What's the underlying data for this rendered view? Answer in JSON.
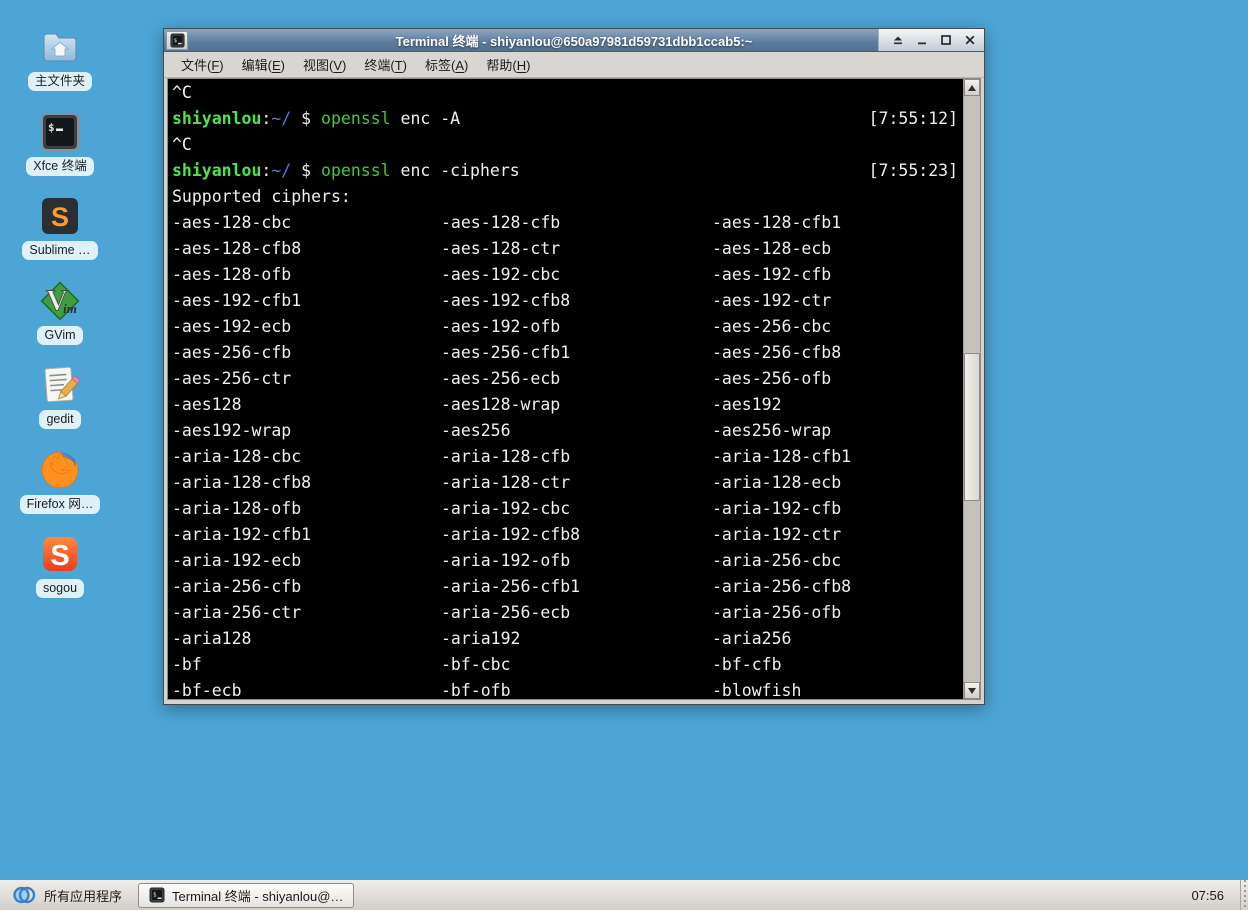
{
  "desktop": {
    "icons": [
      {
        "id": "home-folder",
        "label": "主文件夹"
      },
      {
        "id": "xfce-terminal",
        "label": "Xfce 终端"
      },
      {
        "id": "sublime",
        "label": "Sublime …"
      },
      {
        "id": "gvim",
        "label": "GVim"
      },
      {
        "id": "gedit",
        "label": "gedit"
      },
      {
        "id": "firefox",
        "label": "Firefox 网…"
      },
      {
        "id": "sogou",
        "label": "sogou"
      }
    ]
  },
  "window": {
    "title": "Terminal 终端 - shiyanlou@650a97981d59731dbb1ccab5:~",
    "menu": [
      {
        "id": "file",
        "label": "文件(F)"
      },
      {
        "id": "edit",
        "label": "编辑(E)"
      },
      {
        "id": "view",
        "label": "视图(V)"
      },
      {
        "id": "terminal",
        "label": "终端(T)"
      },
      {
        "id": "tabs",
        "label": "标签(A)"
      },
      {
        "id": "help",
        "label": "帮助(H)"
      }
    ],
    "buttons": [
      {
        "id": "shade"
      },
      {
        "id": "minimize"
      },
      {
        "id": "maximize"
      },
      {
        "id": "close"
      }
    ]
  },
  "terminal": {
    "symbols": {
      "colon": ":",
      "dollar": "$"
    },
    "lines": [
      {
        "type": "plain",
        "text": "^C"
      },
      {
        "type": "prompt",
        "user": "shiyanlou",
        "path": "~/",
        "command": "openssl",
        "args": "enc -A",
        "time": "[7:55:12]"
      },
      {
        "type": "plain",
        "text": "^C"
      },
      {
        "type": "prompt",
        "user": "shiyanlou",
        "path": "~/",
        "command": "openssl",
        "args": "enc -ciphers",
        "time": "[7:55:23]"
      },
      {
        "type": "plain",
        "text": "Supported ciphers:"
      },
      {
        "type": "ciphers",
        "cols": [
          "-aes-128-cbc",
          "-aes-128-cfb",
          "-aes-128-cfb1"
        ]
      },
      {
        "type": "ciphers",
        "cols": [
          "-aes-128-cfb8",
          "-aes-128-ctr",
          "-aes-128-ecb"
        ]
      },
      {
        "type": "ciphers",
        "cols": [
          "-aes-128-ofb",
          "-aes-192-cbc",
          "-aes-192-cfb"
        ]
      },
      {
        "type": "ciphers",
        "cols": [
          "-aes-192-cfb1",
          "-aes-192-cfb8",
          "-aes-192-ctr"
        ]
      },
      {
        "type": "ciphers",
        "cols": [
          "-aes-192-ecb",
          "-aes-192-ofb",
          "-aes-256-cbc"
        ]
      },
      {
        "type": "ciphers",
        "cols": [
          "-aes-256-cfb",
          "-aes-256-cfb1",
          "-aes-256-cfb8"
        ]
      },
      {
        "type": "ciphers",
        "cols": [
          "-aes-256-ctr",
          "-aes-256-ecb",
          "-aes-256-ofb"
        ]
      },
      {
        "type": "ciphers",
        "cols": [
          "-aes128",
          "-aes128-wrap",
          "-aes192"
        ]
      },
      {
        "type": "ciphers",
        "cols": [
          "-aes192-wrap",
          "-aes256",
          "-aes256-wrap"
        ]
      },
      {
        "type": "ciphers",
        "cols": [
          "-aria-128-cbc",
          "-aria-128-cfb",
          "-aria-128-cfb1"
        ]
      },
      {
        "type": "ciphers",
        "cols": [
          "-aria-128-cfb8",
          "-aria-128-ctr",
          "-aria-128-ecb"
        ]
      },
      {
        "type": "ciphers",
        "cols": [
          "-aria-128-ofb",
          "-aria-192-cbc",
          "-aria-192-cfb"
        ]
      },
      {
        "type": "ciphers",
        "cols": [
          "-aria-192-cfb1",
          "-aria-192-cfb8",
          "-aria-192-ctr"
        ]
      },
      {
        "type": "ciphers",
        "cols": [
          "-aria-192-ecb",
          "-aria-192-ofb",
          "-aria-256-cbc"
        ]
      },
      {
        "type": "ciphers",
        "cols": [
          "-aria-256-cfb",
          "-aria-256-cfb1",
          "-aria-256-cfb8"
        ]
      },
      {
        "type": "ciphers",
        "cols": [
          "-aria-256-ctr",
          "-aria-256-ecb",
          "-aria-256-ofb"
        ]
      },
      {
        "type": "ciphers",
        "cols": [
          "-aria128",
          "-aria192",
          "-aria256"
        ]
      },
      {
        "type": "ciphers",
        "cols": [
          "-bf",
          "-bf-cbc",
          "-bf-cfb"
        ]
      },
      {
        "type": "ciphers",
        "cols": [
          "-bf-ecb",
          "-bf-ofb",
          "-blowfish"
        ]
      }
    ]
  },
  "taskbar": {
    "apps_label": "所有应用程序",
    "task_label": "Terminal 终端 - shiyanlou@…",
    "clock": "07:56"
  },
  "colors": {
    "desktop_blue": "#4da5d6",
    "terminal_bg": "#000000",
    "terminal_fg": "#f0f0f0",
    "prompt_user_green": "#4ce64c",
    "prompt_path_blue": "#4e7dd0",
    "command_green": "#3ecc3e",
    "titlebar_blue": "#5e7c9e"
  }
}
